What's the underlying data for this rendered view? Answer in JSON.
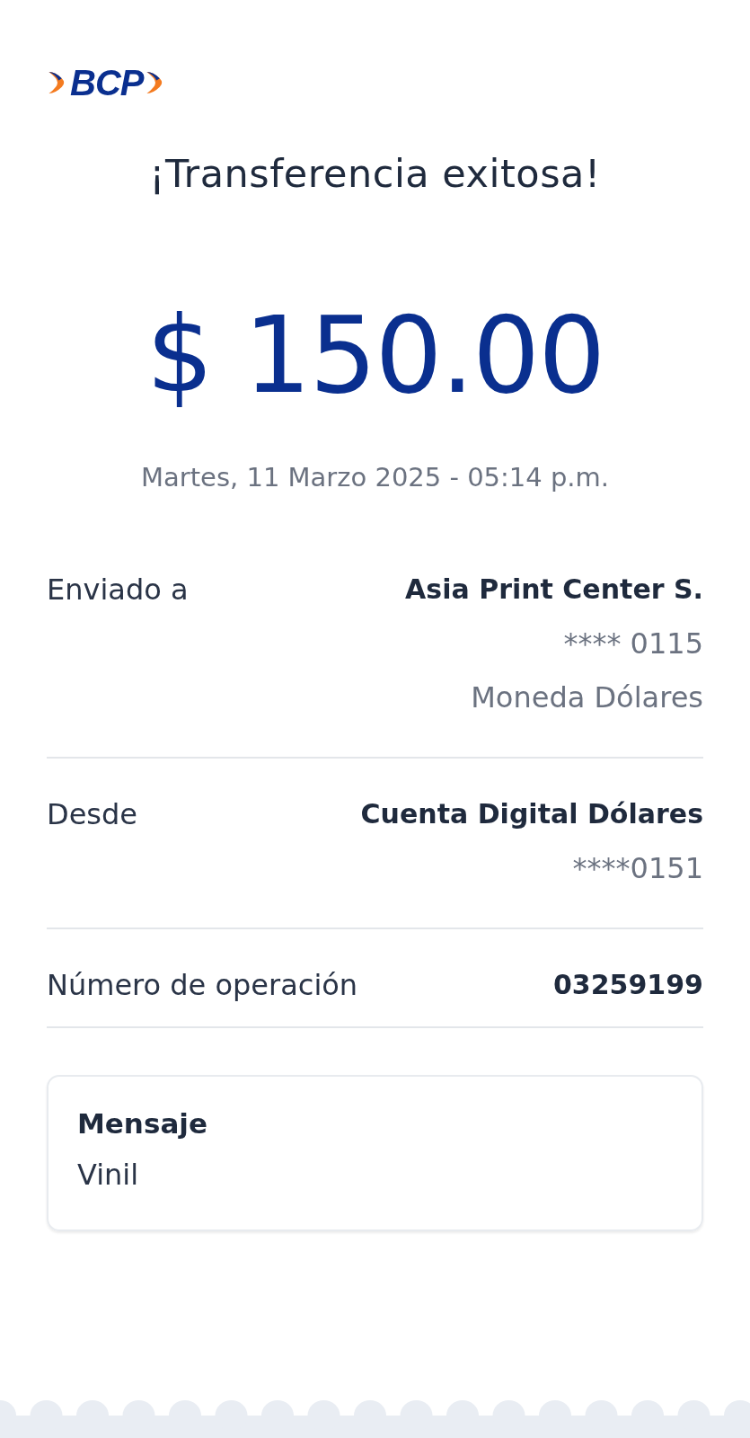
{
  "logo": {
    "text": "BCP"
  },
  "title": "¡Transferencia exitosa!",
  "amount": "$ 150.00",
  "datetime": "Martes, 11 Marzo 2025 - 05:14 p.m.",
  "details": [
    {
      "label": "Enviado a",
      "lines": [
        {
          "text": "Asia Print Center S.",
          "bold": true
        },
        {
          "text": "**** 0115",
          "bold": false
        },
        {
          "text": "Moneda Dólares",
          "bold": false
        }
      ]
    },
    {
      "label": "Desde",
      "lines": [
        {
          "text": "Cuenta Digital Dólares",
          "bold": true
        },
        {
          "text": "****0151",
          "bold": false
        }
      ]
    },
    {
      "label": "Número de operación",
      "lines": [
        {
          "text": "03259199",
          "bold": true
        }
      ]
    }
  ],
  "message": {
    "label": "Mensaje",
    "text": "Vinil"
  }
}
